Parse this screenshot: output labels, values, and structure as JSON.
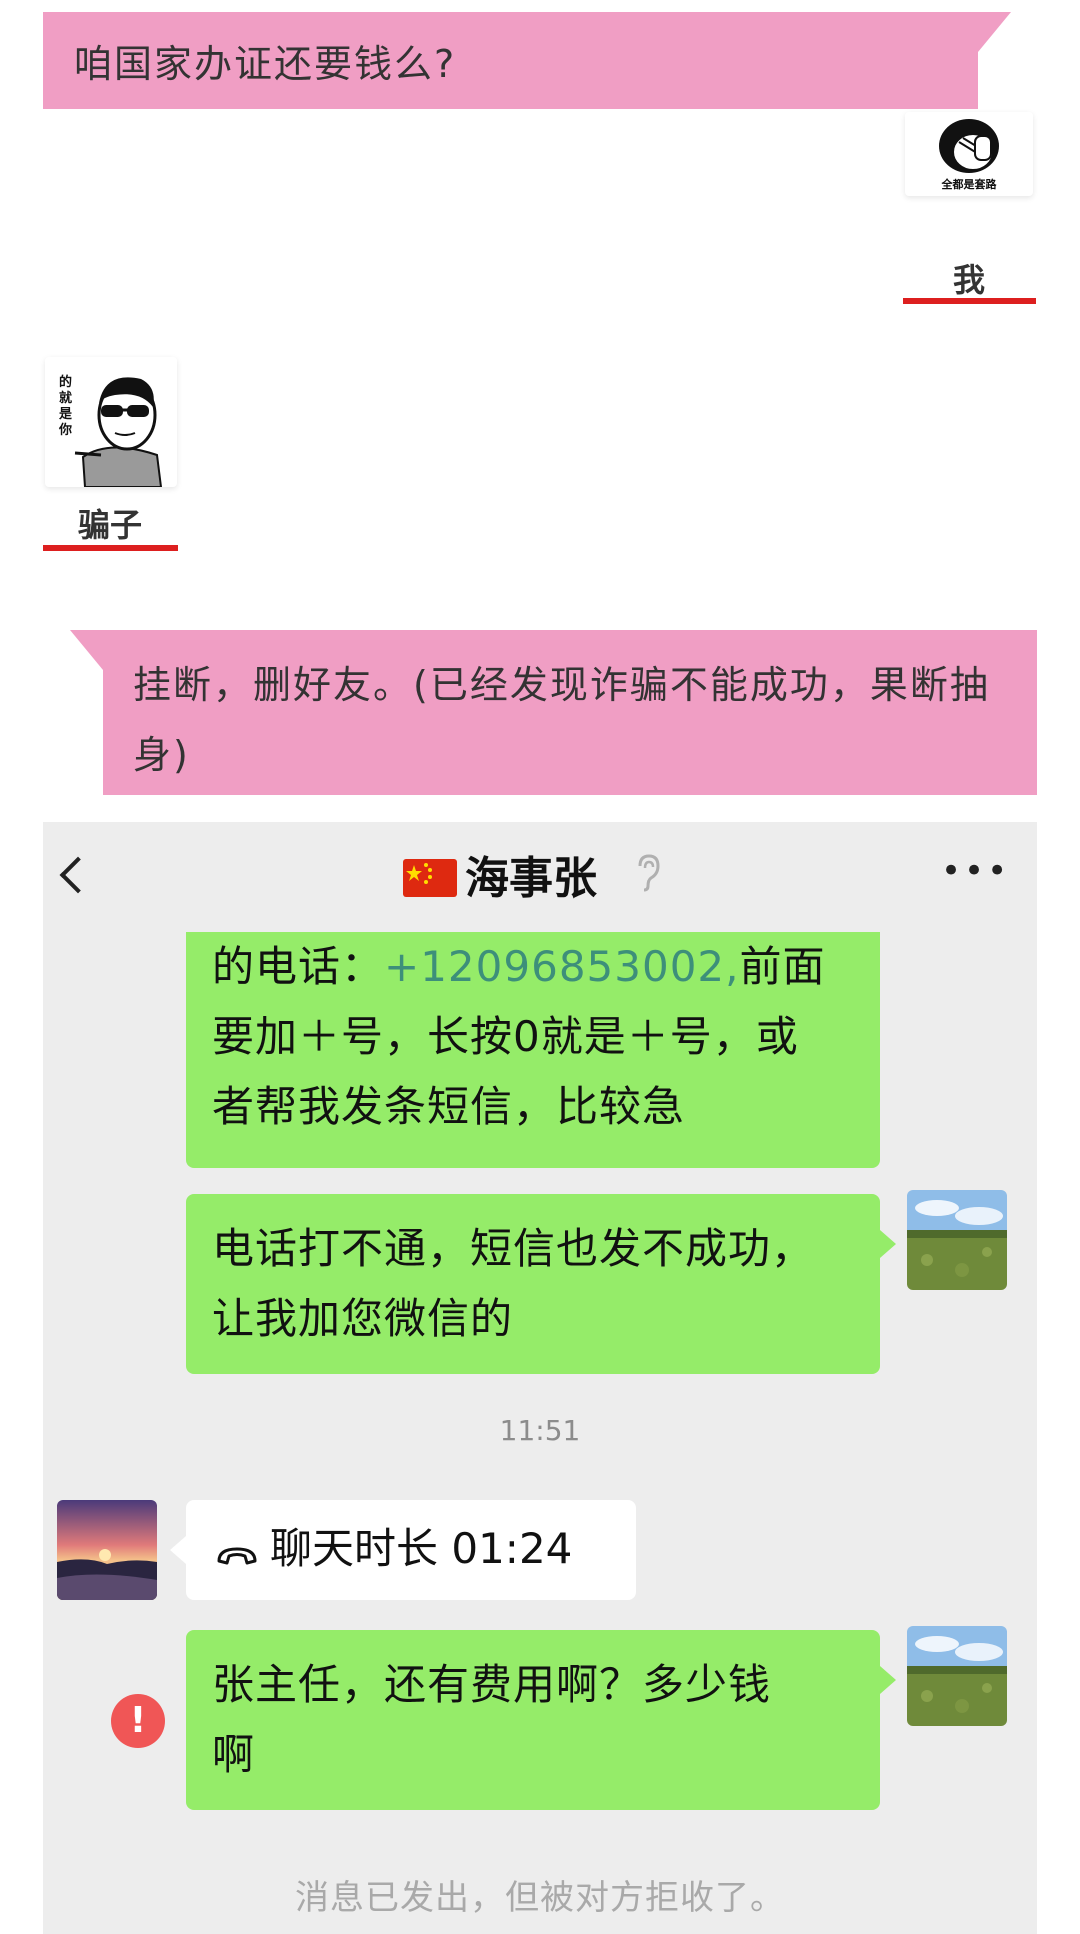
{
  "story": {
    "question": "咱国家办证还要钱么?",
    "me_sticker_caption": "全都是套路",
    "me_label": "我",
    "scammer_sticker_text": "的就是你",
    "scammer_label": "骗子",
    "action_text": "挂断，删好友。(已经发现诈骗不能成功，果断抽身)"
  },
  "colors": {
    "pink": "#f09ec4",
    "underline_red": "#dd1f1f",
    "chat_bg": "#ededed",
    "bubble_green": "#95ec69",
    "phone_link": "#3d8f7a",
    "error_red": "#f05656"
  },
  "chat": {
    "header": {
      "back_icon": "chevron-left-icon",
      "flag_icon": "china-flag-icon",
      "contact_name": "海事张",
      "ear_icon": "ear-icon",
      "more_icon": "more-dots-icon"
    },
    "messages": {
      "m1_prefix": "的电话：",
      "m1_phone": "+12096853002,",
      "m1_suffix_line1": "前面",
      "m1_line2": "要加＋号，长按0就是＋号，或",
      "m1_line3": "者帮我发条短信，比较急",
      "m2_line1": "电话打不通，短信也发不成功，",
      "m2_line2": "让我加您微信的",
      "timestamp": "11:51",
      "call_duration": "聊天时长 01:24",
      "m3_line1": "张主任，还有费用啊？多少钱",
      "m3_line2": "啊",
      "error_mark": "!",
      "system_notice": "消息已发出，但被对方拒收了。"
    }
  }
}
